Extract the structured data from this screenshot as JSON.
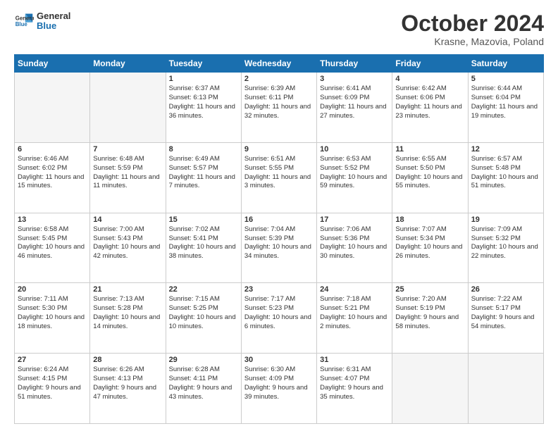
{
  "header": {
    "logo_line1": "General",
    "logo_line2": "Blue",
    "month": "October 2024",
    "location": "Krasne, Mazovia, Poland"
  },
  "weekdays": [
    "Sunday",
    "Monday",
    "Tuesday",
    "Wednesday",
    "Thursday",
    "Friday",
    "Saturday"
  ],
  "weeks": [
    [
      {
        "day": "",
        "info": ""
      },
      {
        "day": "",
        "info": ""
      },
      {
        "day": "1",
        "info": "Sunrise: 6:37 AM\nSunset: 6:13 PM\nDaylight: 11 hours and 36 minutes."
      },
      {
        "day": "2",
        "info": "Sunrise: 6:39 AM\nSunset: 6:11 PM\nDaylight: 11 hours and 32 minutes."
      },
      {
        "day": "3",
        "info": "Sunrise: 6:41 AM\nSunset: 6:09 PM\nDaylight: 11 hours and 27 minutes."
      },
      {
        "day": "4",
        "info": "Sunrise: 6:42 AM\nSunset: 6:06 PM\nDaylight: 11 hours and 23 minutes."
      },
      {
        "day": "5",
        "info": "Sunrise: 6:44 AM\nSunset: 6:04 PM\nDaylight: 11 hours and 19 minutes."
      }
    ],
    [
      {
        "day": "6",
        "info": "Sunrise: 6:46 AM\nSunset: 6:02 PM\nDaylight: 11 hours and 15 minutes."
      },
      {
        "day": "7",
        "info": "Sunrise: 6:48 AM\nSunset: 5:59 PM\nDaylight: 11 hours and 11 minutes."
      },
      {
        "day": "8",
        "info": "Sunrise: 6:49 AM\nSunset: 5:57 PM\nDaylight: 11 hours and 7 minutes."
      },
      {
        "day": "9",
        "info": "Sunrise: 6:51 AM\nSunset: 5:55 PM\nDaylight: 11 hours and 3 minutes."
      },
      {
        "day": "10",
        "info": "Sunrise: 6:53 AM\nSunset: 5:52 PM\nDaylight: 10 hours and 59 minutes."
      },
      {
        "day": "11",
        "info": "Sunrise: 6:55 AM\nSunset: 5:50 PM\nDaylight: 10 hours and 55 minutes."
      },
      {
        "day": "12",
        "info": "Sunrise: 6:57 AM\nSunset: 5:48 PM\nDaylight: 10 hours and 51 minutes."
      }
    ],
    [
      {
        "day": "13",
        "info": "Sunrise: 6:58 AM\nSunset: 5:45 PM\nDaylight: 10 hours and 46 minutes."
      },
      {
        "day": "14",
        "info": "Sunrise: 7:00 AM\nSunset: 5:43 PM\nDaylight: 10 hours and 42 minutes."
      },
      {
        "day": "15",
        "info": "Sunrise: 7:02 AM\nSunset: 5:41 PM\nDaylight: 10 hours and 38 minutes."
      },
      {
        "day": "16",
        "info": "Sunrise: 7:04 AM\nSunset: 5:39 PM\nDaylight: 10 hours and 34 minutes."
      },
      {
        "day": "17",
        "info": "Sunrise: 7:06 AM\nSunset: 5:36 PM\nDaylight: 10 hours and 30 minutes."
      },
      {
        "day": "18",
        "info": "Sunrise: 7:07 AM\nSunset: 5:34 PM\nDaylight: 10 hours and 26 minutes."
      },
      {
        "day": "19",
        "info": "Sunrise: 7:09 AM\nSunset: 5:32 PM\nDaylight: 10 hours and 22 minutes."
      }
    ],
    [
      {
        "day": "20",
        "info": "Sunrise: 7:11 AM\nSunset: 5:30 PM\nDaylight: 10 hours and 18 minutes."
      },
      {
        "day": "21",
        "info": "Sunrise: 7:13 AM\nSunset: 5:28 PM\nDaylight: 10 hours and 14 minutes."
      },
      {
        "day": "22",
        "info": "Sunrise: 7:15 AM\nSunset: 5:25 PM\nDaylight: 10 hours and 10 minutes."
      },
      {
        "day": "23",
        "info": "Sunrise: 7:17 AM\nSunset: 5:23 PM\nDaylight: 10 hours and 6 minutes."
      },
      {
        "day": "24",
        "info": "Sunrise: 7:18 AM\nSunset: 5:21 PM\nDaylight: 10 hours and 2 minutes."
      },
      {
        "day": "25",
        "info": "Sunrise: 7:20 AM\nSunset: 5:19 PM\nDaylight: 9 hours and 58 minutes."
      },
      {
        "day": "26",
        "info": "Sunrise: 7:22 AM\nSunset: 5:17 PM\nDaylight: 9 hours and 54 minutes."
      }
    ],
    [
      {
        "day": "27",
        "info": "Sunrise: 6:24 AM\nSunset: 4:15 PM\nDaylight: 9 hours and 51 minutes."
      },
      {
        "day": "28",
        "info": "Sunrise: 6:26 AM\nSunset: 4:13 PM\nDaylight: 9 hours and 47 minutes."
      },
      {
        "day": "29",
        "info": "Sunrise: 6:28 AM\nSunset: 4:11 PM\nDaylight: 9 hours and 43 minutes."
      },
      {
        "day": "30",
        "info": "Sunrise: 6:30 AM\nSunset: 4:09 PM\nDaylight: 9 hours and 39 minutes."
      },
      {
        "day": "31",
        "info": "Sunrise: 6:31 AM\nSunset: 4:07 PM\nDaylight: 9 hours and 35 minutes."
      },
      {
        "day": "",
        "info": ""
      },
      {
        "day": "",
        "info": ""
      }
    ]
  ]
}
